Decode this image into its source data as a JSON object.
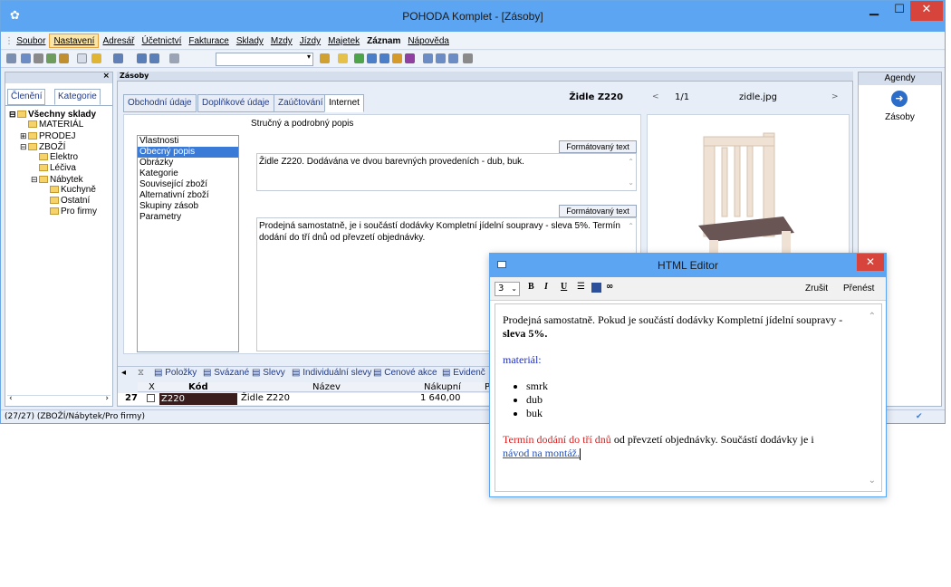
{
  "window": {
    "title": "POHODA Komplet - [Zásoby]"
  },
  "menu": [
    {
      "label": "Soubor",
      "active": false,
      "bold": false
    },
    {
      "label": "Nastavení",
      "active": true,
      "bold": false
    },
    {
      "label": "Adresář",
      "active": false,
      "bold": false
    },
    {
      "label": "Účetnictví",
      "active": false,
      "bold": false
    },
    {
      "label": "Fakturace",
      "active": false,
      "bold": false
    },
    {
      "label": "Sklady",
      "active": false,
      "bold": false
    },
    {
      "label": "Mzdy",
      "active": false,
      "bold": false
    },
    {
      "label": "Jízdy",
      "active": false,
      "bold": false
    },
    {
      "label": "Majetek",
      "active": false,
      "bold": false
    },
    {
      "label": "Záznam",
      "active": false,
      "bold": true
    },
    {
      "label": "Nápověda",
      "active": false,
      "bold": false
    }
  ],
  "left_panel": {
    "close": "×",
    "tabs": [
      "Členění",
      "Kategorie"
    ],
    "tree": [
      {
        "label": "Všechny sklady",
        "level": 0,
        "bold": true,
        "expander": "⊟"
      },
      {
        "label": "MATERIÁL",
        "level": 1,
        "bold": false,
        "expander": ""
      },
      {
        "label": "PRODEJ",
        "level": 1,
        "bold": false,
        "expander": "⊞"
      },
      {
        "label": "ZBOŽÍ",
        "level": 1,
        "bold": false,
        "expander": "⊟"
      },
      {
        "label": "Elektro",
        "level": 2,
        "bold": false,
        "expander": ""
      },
      {
        "label": "Léčiva",
        "level": 2,
        "bold": false,
        "expander": ""
      },
      {
        "label": "Nábytek",
        "level": 2,
        "bold": false,
        "expander": "⊟"
      },
      {
        "label": "Kuchyně",
        "level": 3,
        "bold": false,
        "expander": ""
      },
      {
        "label": "Ostatní",
        "level": 3,
        "bold": false,
        "expander": ""
      },
      {
        "label": "Pro firmy",
        "level": 3,
        "bold": false,
        "expander": ""
      }
    ]
  },
  "center": {
    "header": "Zásoby",
    "tabs": [
      {
        "label": "Obchodní údaje",
        "active": false
      },
      {
        "label": "Doplňkové údaje",
        "active": false
      },
      {
        "label": "Zaúčtování",
        "active": false
      },
      {
        "label": "Internet",
        "active": true
      }
    ],
    "record_title": "Židle Z220",
    "photo_counter": "1/1",
    "photo_filename": "zidle.jpg",
    "section_heading": "Stručný a podrobný popis",
    "properties": [
      {
        "label": "Vlastnosti",
        "selected": false
      },
      {
        "label": "Obecný popis",
        "selected": true
      },
      {
        "label": "Obrázky",
        "selected": false
      },
      {
        "label": "Kategorie",
        "selected": false
      },
      {
        "label": "Související zboží",
        "selected": false
      },
      {
        "label": "Alternativní zboží",
        "selected": false
      },
      {
        "label": "Skupiny zásob",
        "selected": false
      },
      {
        "label": "Parametry",
        "selected": false
      }
    ],
    "format_button_label": "Formátovaný text",
    "short_desc": "Židle Z220. Dodávána ve dvou barevných provedeních - dub, buk.",
    "long_desc": "Prodejná samostatně, je i součástí dodávky Kompletní jídelní soupravy - sleva 5%. Termín dodání do tří dnů od převzetí objednávky."
  },
  "bottom_tabs": [
    "Položky",
    "Svázané",
    "Slevy",
    "Individuální slevy",
    "Cenové akce",
    "Evidenč"
  ],
  "table": {
    "headers": [
      "X",
      "Kód",
      "Název",
      "Nákupní",
      "P"
    ],
    "row": {
      "number": "27",
      "kod": "Z220",
      "nazev": "Židle Z220",
      "nakupni": "1 640,00"
    }
  },
  "status": {
    "text": "(27/27) (ZBOŽÍ/Nábytek/Pro firmy)"
  },
  "agendy": {
    "header": "Agendy",
    "item": "Zásoby"
  },
  "editor": {
    "title": "HTML Editor",
    "font_size": "3",
    "tools": [
      "B",
      "I",
      "U"
    ],
    "zrusit": "Zrušit",
    "prenest": "Přenést",
    "p1": "Prodejná samostatně. Pokud je součástí dodávky Kompletní jídelní soupravy - ",
    "p1_bold": "sleva 5%.",
    "p2": "materiál:",
    "list": [
      "smrk",
      "dub",
      "buk"
    ],
    "p3_red": "Termín dodání do tří dnů",
    "p3_rest": " od převzetí objednávky. Součástí dodávky je i",
    "link": "návod na montáž."
  },
  "colors": {
    "titlebar": "#5ba5f2",
    "close": "#d7443b",
    "selected": "#3b7bd8",
    "menu_active": "#fbe5a7"
  }
}
